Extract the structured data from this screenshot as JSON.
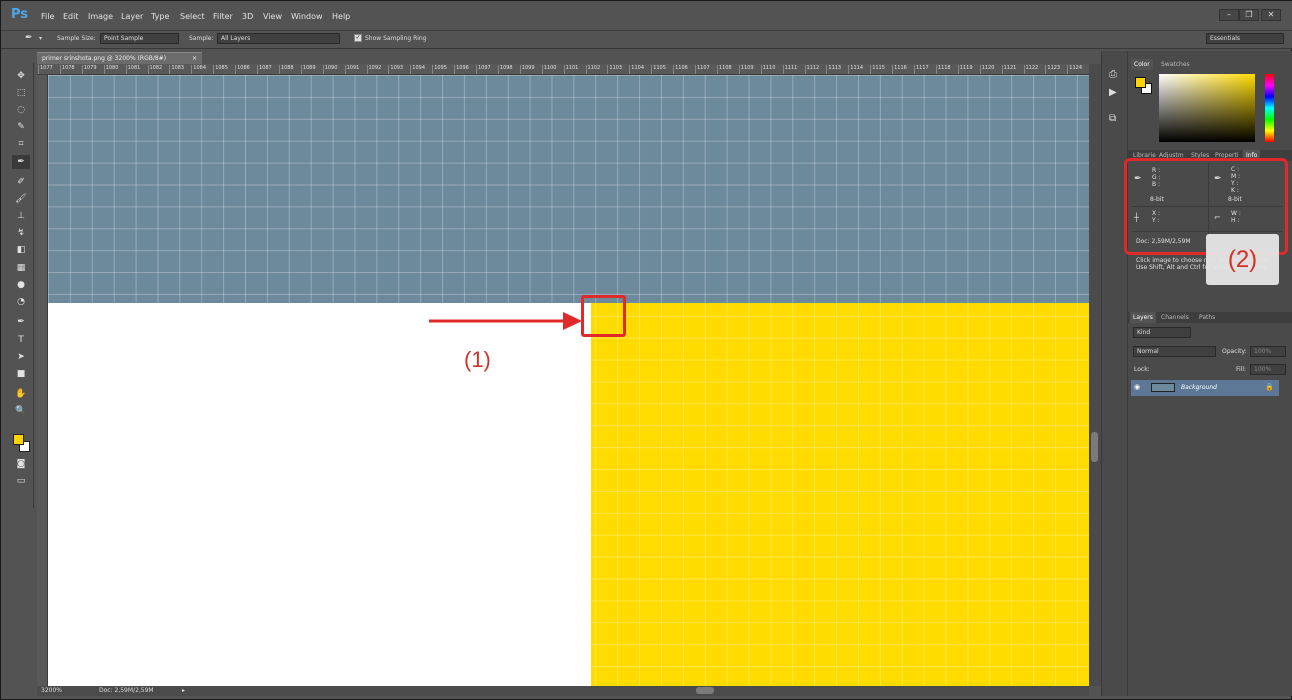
{
  "app": {
    "logo": "Ps",
    "name": "Adobe Photoshop"
  },
  "menu": [
    "File",
    "Edit",
    "Image",
    "Layer",
    "Type",
    "Select",
    "Filter",
    "3D",
    "View",
    "Window",
    "Help"
  ],
  "window_controls": {
    "minimize": "–",
    "restore": "❐",
    "close": "✕"
  },
  "options_bar": {
    "sample_size_label": "Sample Size:",
    "sample_size_value": "Point Sample",
    "sample_label": "Sample:",
    "sample_value": "All Layers",
    "show_ring_label": "Show Sampling Ring",
    "workspace": "Essentials"
  },
  "document": {
    "tab_title": "primer srinshota.png @ 3200% (RGB/8#)",
    "tab_close": "×",
    "zoom": "3200%",
    "doc_size": "Doc: 2,59M/2,59M"
  },
  "ruler_ticks": [
    "1077",
    "1078",
    "1079",
    "1080",
    "1081",
    "1082",
    "1083",
    "1084",
    "1085",
    "1086",
    "1087",
    "1088",
    "1089",
    "1090",
    "1091",
    "1092",
    "1093",
    "1094",
    "1095",
    "1096",
    "1097",
    "1098",
    "1099",
    "1100",
    "1101",
    "1102",
    "1103",
    "1104",
    "1105",
    "1106",
    "1107",
    "1108",
    "1109",
    "1110",
    "1111",
    "1112",
    "1113",
    "1114",
    "1115",
    "1116",
    "1117",
    "1118",
    "1119",
    "1120",
    "1121",
    "1122",
    "1123",
    "1124",
    "1125",
    "1"
  ],
  "colors": {
    "blue_area": "#6d899c",
    "yellow_area": "#ffdb00",
    "foreground": "#ffd400",
    "annotation": "#e02a2a"
  },
  "color_panel": {
    "tabs": [
      "Color",
      "Swatches"
    ]
  },
  "info_panel": {
    "tabs": [
      "Librarie",
      "Adjustm",
      "Styles",
      "Properti",
      "Info"
    ],
    "rgb": {
      "r": "R :",
      "g": "G :",
      "b": "B :"
    },
    "cmyk": {
      "c": "C :",
      "m": "M :",
      "y": "Y :",
      "k": "K :"
    },
    "bit_left": "8-bit",
    "bit_right": "8-bit",
    "xy": {
      "x": "X :",
      "y": "Y :"
    },
    "wh": {
      "w": "W :",
      "h": "H :"
    },
    "doc": "Doc: 2,59M/2,59M",
    "hint1": "Click image to choose new foreground color.",
    "hint2": "Use Shift, Alt and Ctrl for additional options."
  },
  "layers_panel": {
    "tabs": [
      "Layers",
      "Channels",
      "Paths"
    ],
    "kind": "Kind",
    "blend": "Normal",
    "opacity_label": "Opacity:",
    "opacity": "100%",
    "lock_label": "Lock:",
    "fill_label": "Fill:",
    "fill": "100%",
    "layer_name": "Background"
  },
  "annotations": {
    "label1": "(1)",
    "label2": "(2)"
  }
}
